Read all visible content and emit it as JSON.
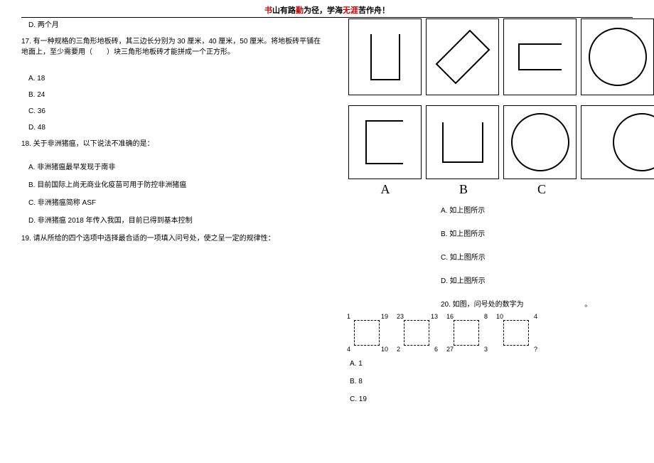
{
  "header": {
    "p1a": "书",
    "p1b": "山有路",
    "p1c": "勤",
    "p1d": "为径，学海",
    "p1e": "无涯",
    "p1f": "苦作舟！"
  },
  "q16d": "D. 两个月",
  "q17": {
    "text": "17. 有一种规格的三角形地板砖，其三边长分别为 30 厘米，40 厘米，50 厘米。将地板砖平铺在地面上，至少需要用（　　）块三角形地板砖才能拼成一个正方形。",
    "a": "A. 18",
    "b": "B. 24",
    "c": "C. 36",
    "d": "D. 48"
  },
  "q18": {
    "text": "18. 关于非洲猪瘟，以下说法不准确的是：",
    "a": "A. 非洲猪瘟最早发现于南非",
    "b": "B. 目前国际上尚无商业化疫苗可用于防控非洲猪瘟",
    "c": "C. 非洲猪瘟简称 ASF",
    "d": "D. 非洲猪瘟 2018 年传入我国，目前已得到基本控制"
  },
  "q19": {
    "text": "19. 请从所给的四个选项中选择最合适的一项填入问号处，使之呈一定的规律性：",
    "labels": {
      "a": "A",
      "b": "B",
      "c": "C"
    },
    "a": "A. 如上图所示",
    "b": "B. 如上图所示",
    "c": "C. 如上图所示",
    "d": "D. 如上图所示"
  },
  "q20": {
    "text_a": "20. 如图，问号处的数字为",
    "text_b": "。",
    "squares": [
      {
        "tl": "1",
        "tr": "19",
        "bl": "4",
        "br": "10"
      },
      {
        "tl": "23",
        "tr": "13",
        "bl": "2",
        "br": "6"
      },
      {
        "tl": "16",
        "tr": "8",
        "bl": "27",
        "br": "3"
      },
      {
        "tl": "10",
        "tr": "4",
        "bl": "",
        "br": "?"
      }
    ],
    "a": "A. 1",
    "b": "B. 8",
    "c": "C. 19"
  },
  "chart_data": [
    {
      "type": "table",
      "title": "Q19 sequence shapes (top row)",
      "items": [
        "U-shape (square open top)",
        "diagonal parallelogram",
        "square open right",
        "circle"
      ]
    },
    {
      "type": "table",
      "title": "Q19 answer shapes (bottom row A-C)",
      "items": [
        "A: square open right",
        "B: square open top",
        "C: circle"
      ]
    },
    {
      "type": "table",
      "title": "Q20 corner numbers",
      "categories": [
        "sq1",
        "sq2",
        "sq3",
        "sq4"
      ],
      "series": [
        {
          "name": "TL",
          "values": [
            1,
            23,
            16,
            10
          ]
        },
        {
          "name": "TR",
          "values": [
            19,
            13,
            8,
            4
          ]
        },
        {
          "name": "BL",
          "values": [
            4,
            2,
            27,
            null
          ]
        },
        {
          "name": "BR",
          "values": [
            10,
            6,
            3,
            "?"
          ]
        }
      ]
    }
  ]
}
